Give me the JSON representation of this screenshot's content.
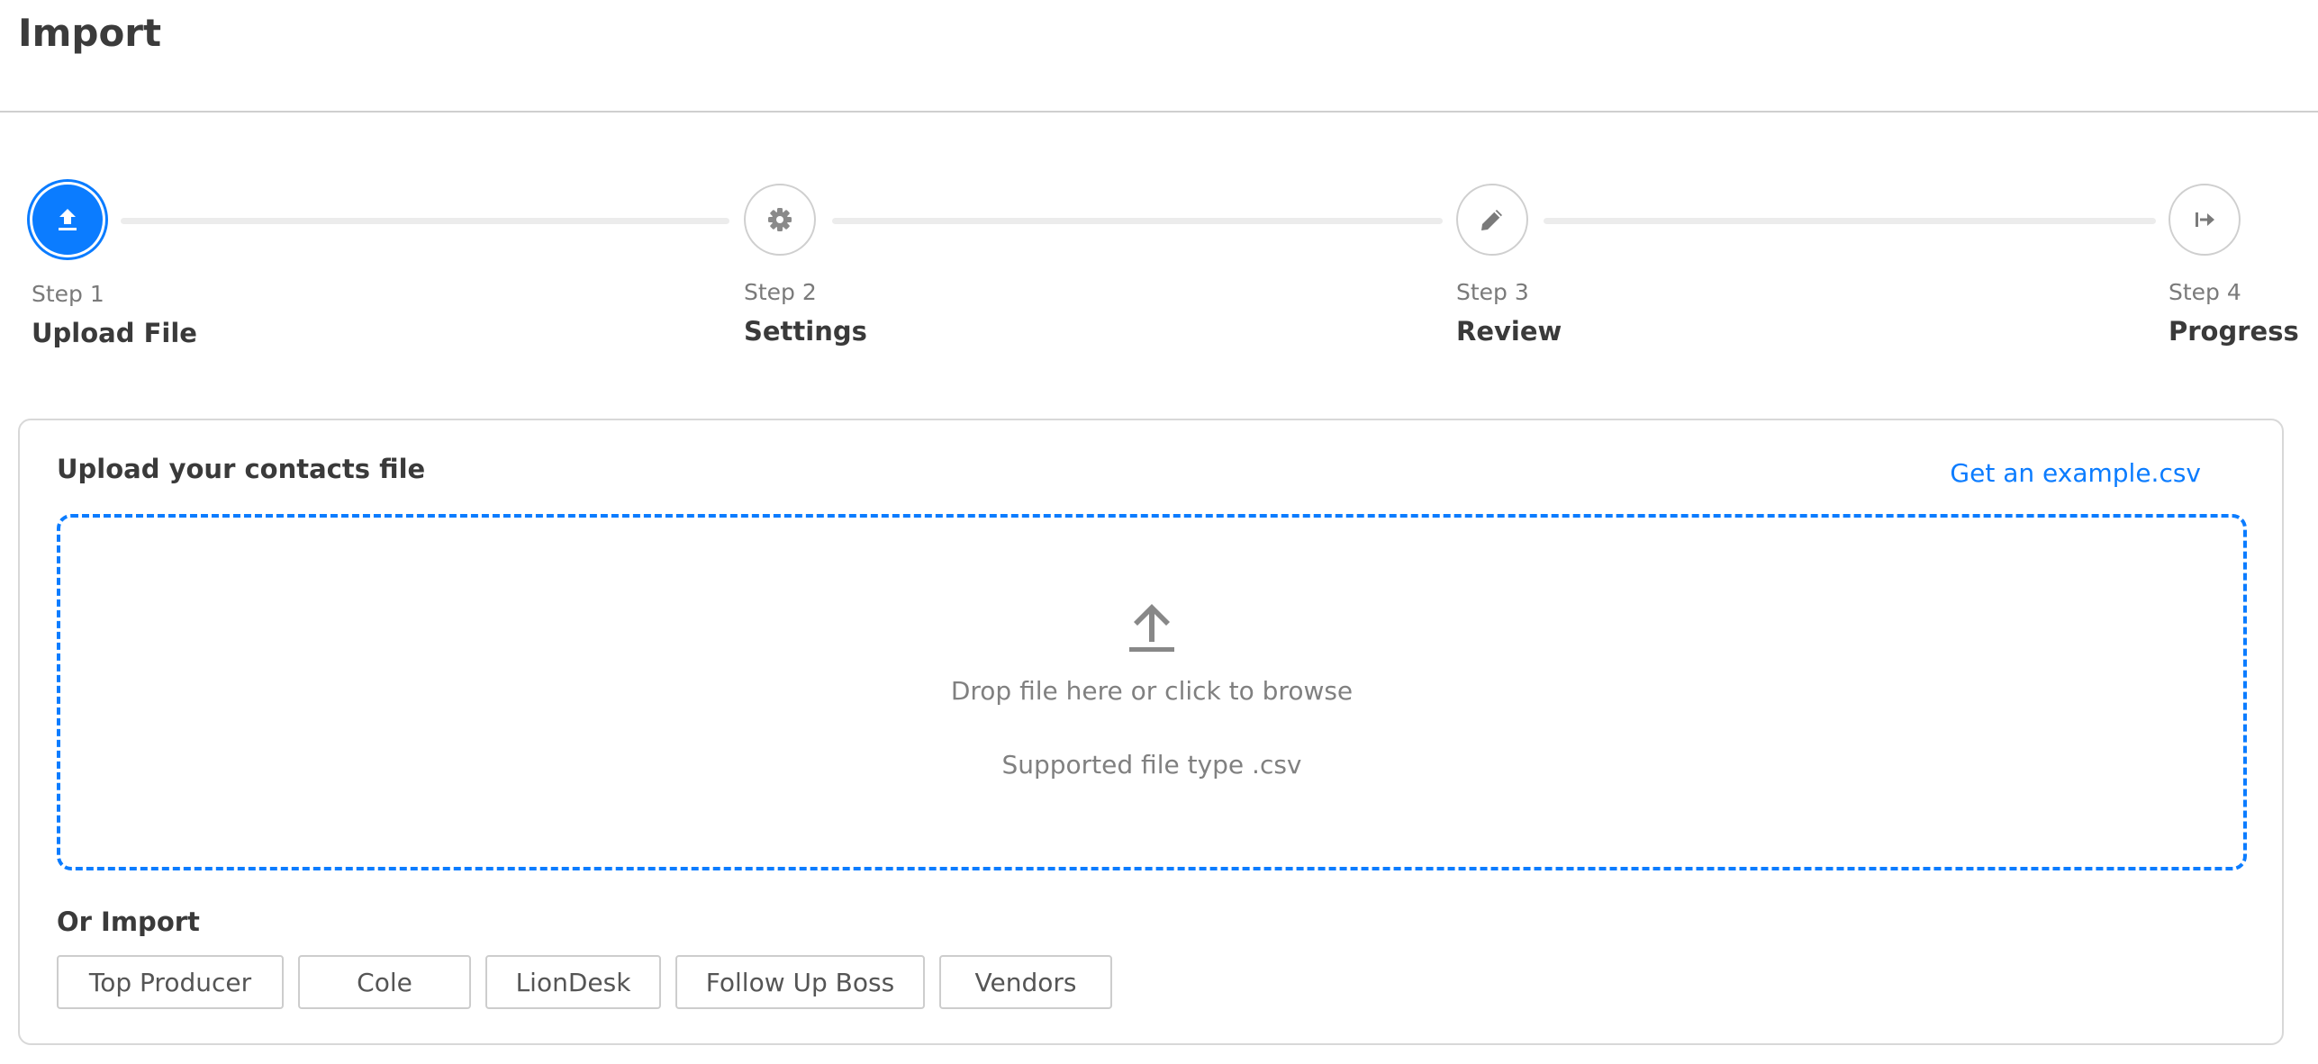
{
  "page": {
    "title": "Import"
  },
  "stepper": {
    "steps": [
      {
        "number_label": "Step 1",
        "title": "Upload File",
        "icon": "upload-icon",
        "active": true
      },
      {
        "number_label": "Step 2",
        "title": "Settings",
        "icon": "gear-icon",
        "active": false
      },
      {
        "number_label": "Step 3",
        "title": "Review",
        "icon": "pencil-icon",
        "active": false
      },
      {
        "number_label": "Step 4",
        "title": "Progress",
        "icon": "arrow-right-to-bar-icon",
        "active": false
      }
    ]
  },
  "upload": {
    "title": "Upload your contacts file",
    "example_link": "Get an example.csv",
    "dropzone": {
      "icon": "upload-arrow-icon",
      "main_text": "Drop file here or click to browse",
      "sub_text": "Supported file type .csv"
    }
  },
  "or_import": {
    "title": "Or Import",
    "buttons": [
      "Top Producer",
      "Cole",
      "LionDesk",
      "Follow Up Boss",
      "Vendors"
    ]
  },
  "colors": {
    "accent": "#0b7cff",
    "border": "#d8d8d8",
    "muted_text": "#808080"
  }
}
